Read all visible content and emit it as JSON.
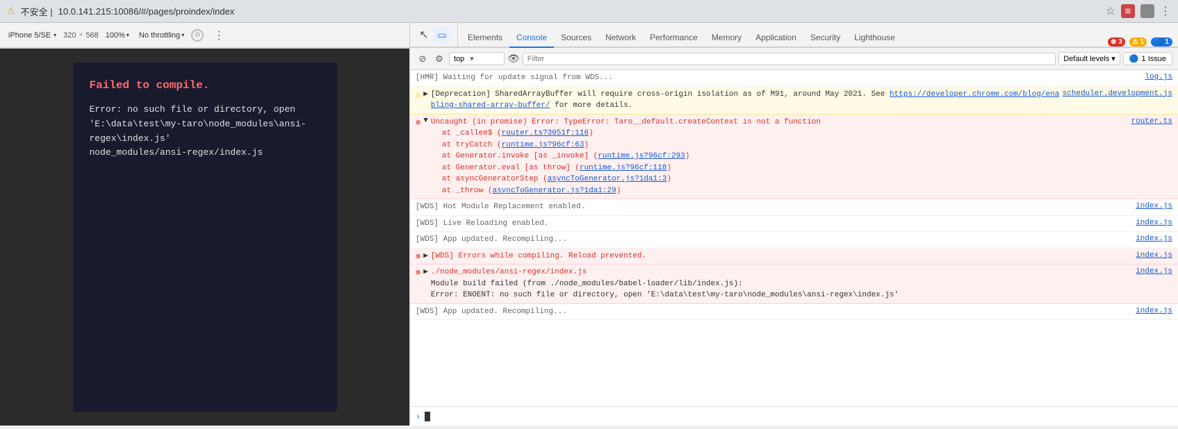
{
  "browser": {
    "warning_icon": "⚠",
    "url": "10.0.141.215:10086/#/pages/proindex/index",
    "url_prefix": "不安全 | ",
    "star_icon": "☆"
  },
  "devtools_top": {
    "device": "iPhone 5/SE",
    "width": "320",
    "x": "×",
    "height": "568",
    "zoom": "100%",
    "throttle": "No throttling",
    "more_icon": "⋮"
  },
  "tabs": {
    "panel_icons": [
      {
        "name": "inspect-icon",
        "char": "↖",
        "active": false
      },
      {
        "name": "device-icon",
        "char": "📱",
        "active": true
      }
    ],
    "items": [
      {
        "id": "elements",
        "label": "Elements",
        "active": false
      },
      {
        "id": "console",
        "label": "Console",
        "active": true
      },
      {
        "id": "sources",
        "label": "Sources",
        "active": false
      },
      {
        "id": "network",
        "label": "Network",
        "active": false
      },
      {
        "id": "performance",
        "label": "Performance",
        "active": false
      },
      {
        "id": "memory",
        "label": "Memory",
        "active": false
      },
      {
        "id": "application",
        "label": "Application",
        "active": false
      },
      {
        "id": "security",
        "label": "Security",
        "active": false
      },
      {
        "id": "lighthouse",
        "label": "Lighthouse",
        "active": false
      }
    ],
    "badge_red": "⊗ 3",
    "badge_yellow": "⚠ 1",
    "badge_blue": "🔵 1"
  },
  "console_toolbar": {
    "clear_icon": "🚫",
    "filter_icon": "⊘",
    "context": "top",
    "context_arrow": "▾",
    "eye_icon": "👁",
    "filter_placeholder": "Filter",
    "level_label": "Default levels",
    "level_arrow": "▾",
    "issue_label": "🔵 1 Issue"
  },
  "error_box": {
    "title": "Failed to compile.",
    "body": "Error: no such file or directory, open\n'E:\\data\\test\\my-taro\\node_modules\\ansi-regex\\index.js'\nnode_modules/ansi-regex/index.js"
  },
  "console_messages": [
    {
      "type": "log",
      "text": "[HMR] Waiting for update signal from WDS...",
      "source": "log.js"
    },
    {
      "type": "warn",
      "text": "[Deprecation] SharedArrayBuffer will require cross-origin isolation as of M91, around May 2021. See https://developer.chrome.com/blog/enabling-shared-array-buffer/ for more details.",
      "link_text": "https://developer.chrome.com/blog/enabling-shared-array-buffer/",
      "source": "scheduler.development.js"
    },
    {
      "type": "error",
      "text": "Uncaught (in promise) Error: TypeError: Taro__default.createContext is not a function",
      "source": "router.ts",
      "stack": [
        "at _callee$ (router.ts?3051f:116)",
        "at tryCatch (runtime.js?96cf:63)",
        "at Generator.invoke [as _invoke] (runtime.js?96cf:293)",
        "at Generator.eval [as throw] (runtime.js?96cf:118)",
        "at asyncGeneratorStep (asyncToGenerator.js?1da1:3)",
        "at _throw (asyncToGenerator.js?1da1:29)"
      ]
    },
    {
      "type": "log",
      "text": "[WDS] Hot Module Replacement enabled.",
      "source": "index.js"
    },
    {
      "type": "log",
      "text": "[WDS] Live Reloading enabled.",
      "source": "index.js"
    },
    {
      "type": "log",
      "text": "[WDS] App updated. Recompiling...",
      "source": "index.js"
    },
    {
      "type": "error",
      "text": "[WDS] Errors while compiling. Reload prevented.",
      "source": "index.js"
    },
    {
      "type": "error",
      "text": "./node_modules/ansi-regex/index.js",
      "source": "index.js",
      "extra": [
        "Module build failed (from ./node_modules/babel-loader/lib/index.js):",
        "Error: ENOENT: no such file or directory, open 'E:\\data\\test\\my-taro\\node_modules\\ansi-regex\\index.js'"
      ]
    },
    {
      "type": "log",
      "text": "[WDS] App updated. Recompiling...",
      "source": "index.js"
    }
  ]
}
